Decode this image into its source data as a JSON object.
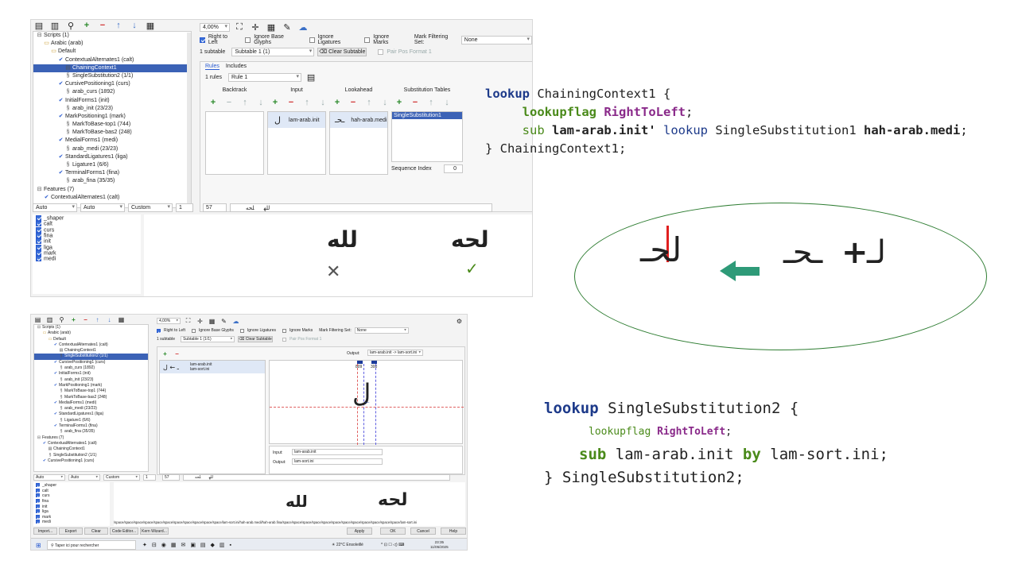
{
  "app1": {
    "zoom": "4,00%",
    "tree": {
      "items": [
        {
          "icon": "minus-box",
          "label": "Scripts (1)",
          "indent": 0,
          "selected": false
        },
        {
          "icon": "folder",
          "label": "Arabic (arab)",
          "indent": 1,
          "selected": false
        },
        {
          "icon": "folder",
          "label": "Default",
          "indent": 2,
          "selected": false
        },
        {
          "icon": "check",
          "label": "ContextualAlternates1 (calt)",
          "indent": 3,
          "selected": false
        },
        {
          "icon": "lookup",
          "label": "ChainingContext1",
          "indent": 4,
          "selected": true
        },
        {
          "icon": "sub",
          "label": "SingleSubstitution2 (1/1)",
          "indent": 4,
          "selected": false
        },
        {
          "icon": "check",
          "label": "CursivePositioning1 (curs)",
          "indent": 3,
          "selected": false
        },
        {
          "icon": "sub",
          "label": "arab_curs (1892)",
          "indent": 4,
          "selected": false
        },
        {
          "icon": "check",
          "label": "InitialForms1 (init)",
          "indent": 3,
          "selected": false
        },
        {
          "icon": "sub",
          "label": "arab_init (23/23)",
          "indent": 4,
          "selected": false
        },
        {
          "icon": "check",
          "label": "MarkPositioning1 (mark)",
          "indent": 3,
          "selected": false
        },
        {
          "icon": "sub",
          "label": "MarkToBase-top1 (744)",
          "indent": 4,
          "selected": false
        },
        {
          "icon": "sub",
          "label": "MarkToBase-bas2 (248)",
          "indent": 4,
          "selected": false
        },
        {
          "icon": "check",
          "label": "MedialForms1 (medi)",
          "indent": 3,
          "selected": false
        },
        {
          "icon": "sub",
          "label": "arab_medi (23/23)",
          "indent": 4,
          "selected": false
        },
        {
          "icon": "check",
          "label": "StandardLigatures1 (liga)",
          "indent": 3,
          "selected": false
        },
        {
          "icon": "sub",
          "label": "Ligature1 (6/6)",
          "indent": 4,
          "selected": false
        },
        {
          "icon": "check",
          "label": "TerminalForms1 (fina)",
          "indent": 3,
          "selected": false
        },
        {
          "icon": "sub",
          "label": "arab_fina (35/35)",
          "indent": 4,
          "selected": false
        },
        {
          "icon": "minus-box",
          "label": "Features (7)",
          "indent": 0,
          "selected": false
        },
        {
          "icon": "check",
          "label": "ContextualAlternates1 (calt)",
          "indent": 1,
          "selected": false
        }
      ]
    },
    "options": {
      "right_to_left": "Right to Left",
      "ignore_base": "Ignore Base Glyphs",
      "ignore_lig": "Ignore Ligatures",
      "ignore_marks": "Ignore Marks",
      "mark_filter_label": "Mark Filtering Set:",
      "mark_filter_value": "None",
      "subtable_count": "1 subtable",
      "subtable_value": "Subtable 1 (1)",
      "clear_subtable": "Clear Subtable",
      "pair_pos": "Pair Pos Format 1"
    },
    "tabs": [
      "Rules",
      "Includes"
    ],
    "rules_count": "1 rules",
    "rule_value": "Rule 1",
    "columns": {
      "backtrack": "Backtrack",
      "input": "Input",
      "lookahead": "Lookahead",
      "sub_tables": "Substitution Tables"
    },
    "input_item": "lam-arab.init",
    "input_glyph": "ل",
    "lookahead_item": "hah-arab.medi",
    "lookahead_glyph": "ـحـ",
    "sub_table_item": "SingleSubstitution1",
    "sequence_index_label": "Sequence Index",
    "sequence_index_value": "0",
    "preview_bar": {
      "script": "Auto",
      "lang": "Auto",
      "dir": "Custom",
      "n": "1",
      "size": "57",
      "text1": "لله",
      "text2": "لحه"
    },
    "features": [
      "_shaper",
      "calt",
      "curs",
      "fina",
      "init",
      "liga",
      "mark",
      "medi"
    ],
    "preview_text_left": "لله",
    "preview_text_right": "لحه",
    "mark_bad": "✕",
    "mark_good": "✓"
  },
  "code1": {
    "lines": [
      {
        "tokens": [
          {
            "t": "lookup",
            "c": "kw"
          },
          {
            "t": " ChainingContext1 {",
            "c": ""
          }
        ]
      },
      {
        "tokens": [
          {
            "t": "     ",
            "c": ""
          },
          {
            "t": "lookupflag",
            "c": "kw2"
          },
          {
            "t": " ",
            "c": ""
          },
          {
            "t": "RightToLeft",
            "c": "kw3"
          },
          {
            "t": ";",
            "c": ""
          }
        ]
      },
      {
        "tokens": [
          {
            "t": "     ",
            "c": ""
          },
          {
            "t": "sub",
            "c": "kw4"
          },
          {
            "t": " ",
            "c": ""
          },
          {
            "t": "lam-arab.init'",
            "c": "bold"
          },
          {
            "t": " ",
            "c": ""
          },
          {
            "t": "lookup",
            "c": "kw5"
          },
          {
            "t": " SingleSubstitution1 ",
            "c": ""
          },
          {
            "t": "hah-arab.medi",
            "c": "bold"
          },
          {
            "t": ";",
            "c": ""
          }
        ]
      },
      {
        "tokens": [
          {
            "t": "} ChainingContext1;",
            "c": ""
          }
        ]
      }
    ]
  },
  "ellipse": {
    "result_glyph": "لحـ",
    "lam_glyph": "لـ",
    "hah_glyph": "ـحـ",
    "plus": "+",
    "accent_color": "#2e9a78"
  },
  "app2": {
    "zoom": "4,00%",
    "tree": {
      "items": [
        {
          "icon": "minus-box",
          "label": "Scripts (1)",
          "indent": 0,
          "selected": false
        },
        {
          "icon": "folder",
          "label": "Arabic (arab)",
          "indent": 1,
          "selected": false
        },
        {
          "icon": "folder",
          "label": "Default",
          "indent": 2,
          "selected": false
        },
        {
          "icon": "check",
          "label": "ContextualAlternates1 (calt)",
          "indent": 3,
          "selected": false
        },
        {
          "icon": "lookup",
          "label": "ChainingContext1",
          "indent": 4,
          "selected": false
        },
        {
          "icon": "sub",
          "label": "SingleSubstitution2 (1/1)",
          "indent": 4,
          "selected": true
        },
        {
          "icon": "check",
          "label": "CursivePositioning1 (curs)",
          "indent": 3,
          "selected": false
        },
        {
          "icon": "sub",
          "label": "arab_curs (1892)",
          "indent": 4,
          "selected": false
        },
        {
          "icon": "check",
          "label": "InitialForms1 (init)",
          "indent": 3,
          "selected": false
        },
        {
          "icon": "sub",
          "label": "arab_init (23/23)",
          "indent": 4,
          "selected": false
        },
        {
          "icon": "check",
          "label": "MarkPositioning1 (mark)",
          "indent": 3,
          "selected": false
        },
        {
          "icon": "sub",
          "label": "MarkToBase-top1 (744)",
          "indent": 4,
          "selected": false
        },
        {
          "icon": "sub",
          "label": "MarkToBase-bas2 (248)",
          "indent": 4,
          "selected": false
        },
        {
          "icon": "check",
          "label": "MedialForms1 (medi)",
          "indent": 3,
          "selected": false
        },
        {
          "icon": "sub",
          "label": "arab_medi (23/23)",
          "indent": 4,
          "selected": false
        },
        {
          "icon": "check",
          "label": "StandardLigatures1 (liga)",
          "indent": 3,
          "selected": false
        },
        {
          "icon": "sub",
          "label": "Ligature1 (6/6)",
          "indent": 4,
          "selected": false
        },
        {
          "icon": "check",
          "label": "TerminalForms1 (fina)",
          "indent": 3,
          "selected": false
        },
        {
          "icon": "sub",
          "label": "arab_fina (35/35)",
          "indent": 4,
          "selected": false
        },
        {
          "icon": "minus-box",
          "label": "Features (7)",
          "indent": 0,
          "selected": false
        },
        {
          "icon": "check",
          "label": "ContextualAlternates1 (calt)",
          "indent": 1,
          "selected": false
        },
        {
          "icon": "lookup",
          "label": "ChainingContext1",
          "indent": 2,
          "selected": false
        },
        {
          "icon": "sub",
          "label": "SingleSubstitution2 (1/1)",
          "indent": 2,
          "selected": false
        },
        {
          "icon": "check",
          "label": "CursivePositioning1 (curs)",
          "indent": 1,
          "selected": false
        }
      ]
    },
    "options": {
      "right_to_left": "Right to Left",
      "ignore_base": "Ignore Base Glyphs",
      "ignore_lig": "Ignore Ligatures",
      "ignore_marks": "Ignore Marks",
      "mark_filter_label": "Mark Filtering Set:",
      "mark_filter_value": "None",
      "subtable_count": "1 subtable",
      "subtable_value": "Subtable 1 (1/1)",
      "clear_subtable": "Clear Subtable",
      "pair_pos": "Pair Pos Format 1"
    },
    "output_label": "Output:",
    "output_value": "lam-arab.init -> lam-sort.ini",
    "pair_glyph": "ل",
    "pair_in": "lam-arab.init",
    "pair_out": "lam-sort.ini",
    "ruler_left": "809",
    "ruler_right": "300",
    "canvas_glyph": "ل",
    "input_label": "Input:",
    "input_value": "lam-arab.init",
    "output_field_label": "Output:",
    "output_field_value": "lam-sort.ini",
    "preview_bar": {
      "script": "Auto",
      "lang": "Auto",
      "dir": "Custom",
      "n": "1",
      "size": "57",
      "text1": "لله",
      "text2": "لحه"
    },
    "features": [
      "_shaper",
      "calt",
      "curs",
      "fina",
      "init",
      "liga",
      "mark",
      "medi"
    ],
    "preview_text_left": "لله",
    "preview_text_right": "لحه",
    "glyph_string": "/space/space/space/space/space/space/space/space/space/space/space/lam-sort.ini/hah-arab.medi/hah-arab.fina/space/space/space/space/space/space/space/space/space/space/space/space/lam-sort.ini",
    "buttons": {
      "import": "Import...",
      "export": "Export",
      "clear": "Clear",
      "code_editor": "Code Editor...",
      "kern_wizard": "Kern Wizard...",
      "apply": "Apply",
      "ok": "OK",
      "cancel": "Cancel",
      "help": "Help"
    },
    "taskbar": {
      "search_placeholder": "Taper ici pour rechercher",
      "weather": "22°C  Ensoleillé",
      "time": "23:35",
      "date": "11/05/2025"
    }
  },
  "code2": {
    "lines": [
      {
        "tokens": [
          {
            "t": "lookup",
            "c": "kw"
          },
          {
            "t": " SingleSubstitution2 {",
            "c": ""
          }
        ]
      },
      {
        "tokens": [
          {
            "t": "lookupflag",
            "c": "kw4"
          },
          {
            "t": " ",
            "c": ""
          },
          {
            "t": "RightToLeft",
            "c": "kw3"
          },
          {
            "t": ";",
            "c": ""
          }
        ]
      },
      {
        "tokens": [
          {
            "t": "sub",
            "c": "kw2"
          },
          {
            "t": " lam-arab.init ",
            "c": ""
          },
          {
            "t": "by",
            "c": "kw2"
          },
          {
            "t": " lam-sort.ini;",
            "c": ""
          }
        ]
      },
      {
        "tokens": [
          {
            "t": "} SingleSubstitution2;",
            "c": ""
          }
        ]
      }
    ]
  }
}
